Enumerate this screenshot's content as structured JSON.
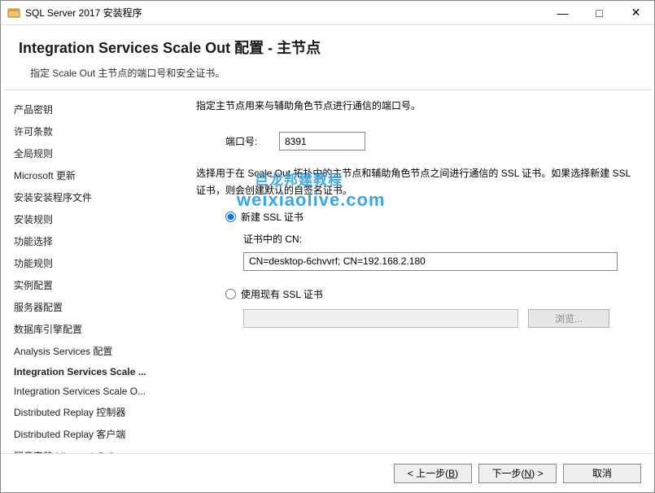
{
  "titlebar": {
    "title": "SQL Server 2017 安装程序"
  },
  "header": {
    "title": "Integration  Services  Scale  Out 配置 - 主节点",
    "subtitle": "指定 Scale Out 主节点的端口号和安全证书。"
  },
  "sidebar": {
    "items": [
      {
        "label": "产品密钥"
      },
      {
        "label": "许可条款"
      },
      {
        "label": "全局规则"
      },
      {
        "label": "Microsoft 更新"
      },
      {
        "label": "安装安装程序文件"
      },
      {
        "label": "安装规则"
      },
      {
        "label": "功能选择"
      },
      {
        "label": "功能规则"
      },
      {
        "label": "实例配置"
      },
      {
        "label": "服务器配置"
      },
      {
        "label": "数据库引擎配置"
      },
      {
        "label": "Analysis Services 配置"
      },
      {
        "label": "Integration Services Scale ...",
        "active": true
      },
      {
        "label": "Integration Services Scale O..."
      },
      {
        "label": "Distributed Replay 控制器"
      },
      {
        "label": "Distributed Replay 客户端"
      },
      {
        "label": "同意安装 Microsoft R Open"
      }
    ]
  },
  "main": {
    "port_desc": "指定主节点用来与辅助角色节点进行通信的端口号。",
    "port_label": "端口号:",
    "port_value": "8391",
    "ssl_desc": "选择用于在 Scale Out 拓扑中的主节点和辅助角色节点之间进行通信的 SSL 证书。如果选择新建 SSL 证书，则会创建默认的自签名证书。",
    "radio_new": "新建 SSL 证书",
    "cn_label": "证书中的 CN:",
    "cn_value": "CN=desktop-6chvvrf; CN=192.168.2.180",
    "radio_existing": "使用现有 SSL 证书",
    "browse_btn": "浏览...",
    "watermark1": "巨龙邦建教程",
    "watermark2": "weixiaolive.com"
  },
  "footer": {
    "back": "< 上一步(B)",
    "next": "下一步(N) >",
    "cancel": "取消"
  }
}
